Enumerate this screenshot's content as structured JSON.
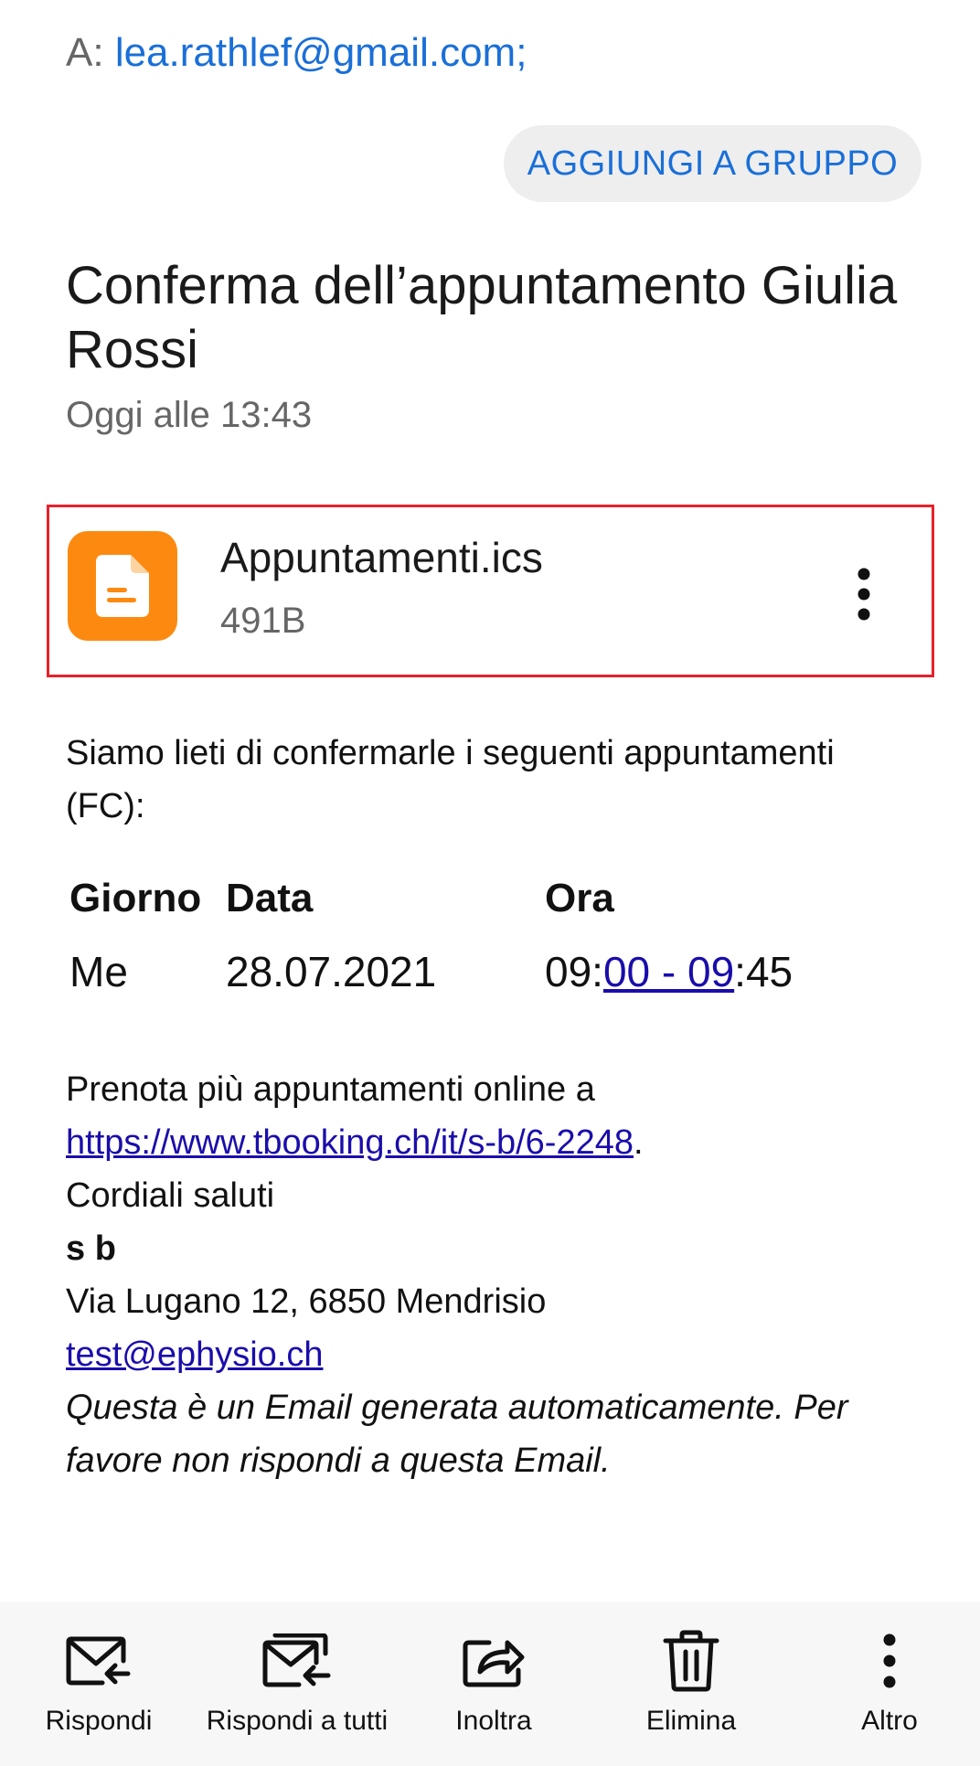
{
  "header": {
    "to_prefix": "A:",
    "to_address": "lea.rathlef@gmail.com;",
    "add_to_group_label": "AGGIUNGI A GRUPPO"
  },
  "message": {
    "subject": "Conferma dell’appuntamento Giulia Rossi",
    "date": "Oggi alle 13:43"
  },
  "attachment": {
    "name": "Appuntamenti.ics",
    "size": "491B",
    "icon": "document-icon",
    "icon_color": "#fd8a10",
    "highlight_color": "#e8212b"
  },
  "body": {
    "intro": "Siamo lieti di confermarle i seguenti appuntamenti (FC):",
    "table": {
      "headers": [
        "Giorno",
        "Data",
        "Ora"
      ],
      "row": {
        "giorno": "Me",
        "data": "28.07.2021",
        "ora_start": "09:",
        "ora_link": "00 - 09",
        "ora_end": ":45"
      }
    },
    "booking_text": "Prenota più appuntamenti online a",
    "booking_link": "https://www.tbooking.ch/it/s-b/6-2248",
    "booking_suffix": ".",
    "greeting": "Cordiali saluti",
    "sender_name": "s b",
    "address": "Via Lugano 12, 6850 Mendrisio",
    "email": "test@ephysio.ch",
    "disclaimer": "Questa è un Email generata automaticamente. Per favore non rispondi a questa Email."
  },
  "toolbar": {
    "items": [
      {
        "label": "Rispondi",
        "icon": "reply-icon"
      },
      {
        "label": "Rispondi a tutti",
        "icon": "reply-all-icon"
      },
      {
        "label": "Inoltra",
        "icon": "forward-icon"
      },
      {
        "label": "Elimina",
        "icon": "trash-icon"
      },
      {
        "label": "Altro",
        "icon": "more-vertical-icon"
      }
    ]
  },
  "colors": {
    "accent": "#1a6fd8",
    "link": "#1a0dab"
  }
}
